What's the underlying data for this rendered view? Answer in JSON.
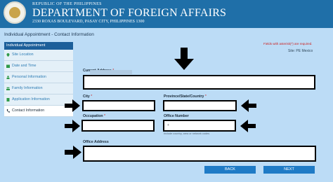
{
  "header": {
    "republic": "REPUBLIC OF THE PHILIPPINES",
    "title": "DEPARTMENT OF FOREIGN AFFAIRS",
    "address": "2330 ROXAS BOULEVARD, PASAY CITY, PHILIPPINES 1300"
  },
  "page_title": "Individual Appointment - Contact Information",
  "sidebar": {
    "heading": "Individual Appointment",
    "items": [
      {
        "label": "Site Location"
      },
      {
        "label": "Date and Time"
      },
      {
        "label": "Personal Information"
      },
      {
        "label": "Family Information"
      },
      {
        "label": "Application Information"
      },
      {
        "label": "Contact Information"
      }
    ]
  },
  "form": {
    "required_note": "Fields with asterisk(*) are required.",
    "site": "Site: PE Mexico",
    "current_address": {
      "label": "Current Address",
      "req": "*"
    },
    "city": {
      "label": "City",
      "req": "*"
    },
    "province": {
      "label": "Province/State/Country",
      "req": "*"
    },
    "occupation": {
      "label": "Occupation",
      "req": "*"
    },
    "office_number": {
      "label": "Office Number",
      "value": "+",
      "hint": "Include country, area or network codes"
    },
    "office_address": {
      "label": "Office Address"
    }
  },
  "buttons": {
    "back": "BACK",
    "next": "NEXT"
  },
  "colors": {
    "header": "#1f6fa8",
    "content_bg": "#bcdcf6",
    "button": "#1f7bc6",
    "required": "#cc2222",
    "link": "#2f7db5"
  }
}
